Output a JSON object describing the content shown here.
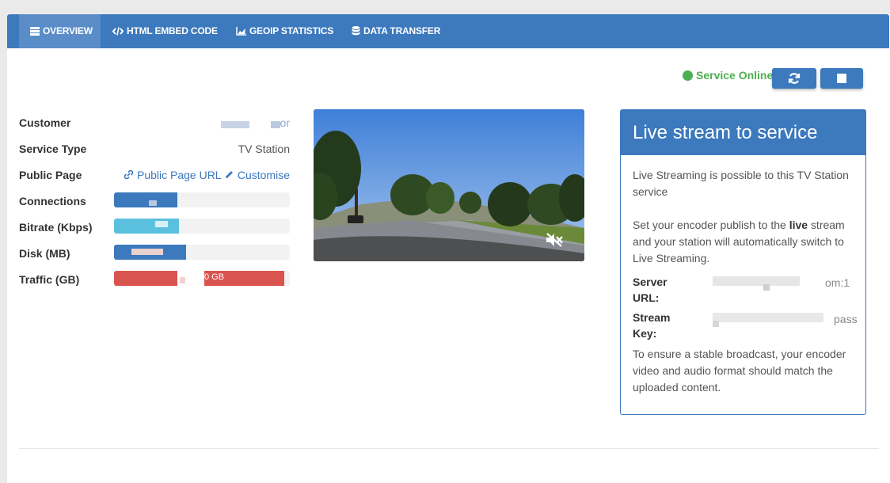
{
  "nav": {
    "tabs": [
      {
        "label": "OVERVIEW",
        "icon": "list-icon",
        "active": true
      },
      {
        "label": "HTML EMBED CODE",
        "icon": "code-icon",
        "active": false
      },
      {
        "label": "GEOIP STATISTICS",
        "icon": "area-chart-icon",
        "active": false
      },
      {
        "label": "DATA TRANSFER",
        "icon": "database-icon",
        "active": false
      }
    ]
  },
  "status": {
    "text": "Service Online",
    "color": "#4caf50"
  },
  "toolbar": {
    "refresh_icon": "refresh-icon",
    "stop_icon": "stop-icon"
  },
  "info": {
    "customer_label": "Customer",
    "customer_value_partial": "or",
    "service_type_label": "Service Type",
    "service_type_value": "TV Station",
    "public_page_label": "Public Page",
    "public_page_link": "Public Page URL",
    "customise_link": "Customise",
    "connections_label": "Connections",
    "bitrate_label": "Bitrate (Kbps)",
    "disk_label": "Disk (MB)",
    "traffic_label": "Traffic (GB)",
    "traffic_value_partial": "0 GB"
  },
  "bars": {
    "connections": {
      "fill": 0.36,
      "color": "#3c79bd"
    },
    "bitrate": {
      "fill": 0.37,
      "color": "#5bc0de"
    },
    "disk": {
      "fill": 0.41,
      "color": "#3c79bd"
    },
    "traffic": {
      "fill": 0.97,
      "color": "#d9534f"
    }
  },
  "video": {
    "muted_icon": "volume-mute-icon"
  },
  "card": {
    "title": "Live stream to service",
    "para1": "Live Streaming is possible to this TV Station service",
    "para2_before": "Set your encoder publish to the ",
    "para2_bold": "live",
    "para2_after": " stream and your station will automatically switch to Live Streaming.",
    "server_url_label": "Server URL:",
    "server_url_partial": "om:1",
    "stream_key_label": "Stream Key:",
    "stream_key_partial": "pass",
    "para3": "To ensure a stable broadcast, your encoder video and audio format should match the uploaded content."
  },
  "colors": {
    "accent": "#3c79bd",
    "tab_active": "#5a8dc8",
    "online": "#4caf50",
    "danger": "#d9534f",
    "info": "#5bc0de"
  }
}
